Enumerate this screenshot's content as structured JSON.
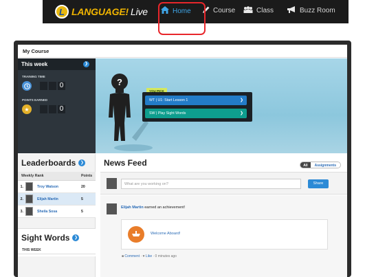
{
  "nav": {
    "logo_letter": "L",
    "logo_main": "LANGUAGE!",
    "logo_live": "Live",
    "items": [
      {
        "label": "Home",
        "icon": "home-icon"
      },
      {
        "label": "Course",
        "icon": "pencil-icon"
      },
      {
        "label": "Class",
        "icon": "people-icon"
      },
      {
        "label": "Buzz Room",
        "icon": "megaphone-icon"
      }
    ],
    "highlight_color": "#e8262b"
  },
  "course": {
    "header": "My Course",
    "week_panel": {
      "title": "This week",
      "training_label": "TRAINING TIME",
      "training_value": "0",
      "points_label": "POINTS EARNED",
      "points_value": "0"
    },
    "avatar_mark": "?",
    "you_pick": "YOU PICK",
    "picks": [
      {
        "label": "WT | U1: Start Lesson 1",
        "color": "#237cc8"
      },
      {
        "label": "SW | Play Sight Words",
        "color": "#0e9e8e"
      }
    ]
  },
  "leaderboards": {
    "title": "Leaderboards",
    "col_rank": "Weekly Rank",
    "col_points": "Points",
    "rows": [
      {
        "rank": "1.",
        "name": "Troy Watson",
        "points": "20"
      },
      {
        "rank": "2.",
        "name": "Elijah Martin",
        "points": "5"
      },
      {
        "rank": "3.",
        "name": "Sheila Sosa",
        "points": "5"
      }
    ]
  },
  "sight_words": {
    "title": "Sight Words",
    "subtitle": "THIS WEEK"
  },
  "feed": {
    "title": "News Feed",
    "toggle_all": "All",
    "toggle_assignments": "Assignments",
    "compose_placeholder": "What are you working on?",
    "share_label": "Share",
    "post": {
      "author": "Elijah Martin",
      "action": " earned an achievement!",
      "achievement": "Welcome Aboard!",
      "comment_label": "Comment",
      "like_label": "Like",
      "time": " · 0 minutes ago"
    }
  }
}
